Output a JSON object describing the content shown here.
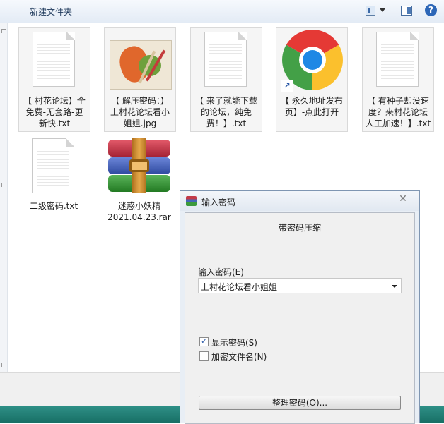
{
  "toolbar": {
    "new_folder": "新建文件夹",
    "help_glyph": "?"
  },
  "files": [
    {
      "label": "【 村花论坛】全\n免费-无套路-更\n新快.txt",
      "icon": "text-file-icon"
    },
    {
      "label": "【 解压密码：】\n上村花论坛看小\n姐姐.jpg",
      "icon": "image-thumbnail"
    },
    {
      "label": "【 来了就能下载\n的论坛，纯免\n费！】.txt",
      "icon": "text-file-icon"
    },
    {
      "label": "【 永久地址发布\n页】-点此打开",
      "icon": "chrome-icon"
    },
    {
      "label": "【 有种子却没速\n度？来村花论坛\n人工加速！】.txt",
      "icon": "text-file-icon"
    },
    {
      "label": "二级密码.txt",
      "icon": "text-file-icon"
    },
    {
      "label": "迷惑小妖精\n2021.04.23.rar",
      "icon": "winrar-archive-icon"
    }
  ],
  "dialog": {
    "title": "输入密码",
    "close_glyph": "✕",
    "heading": "带密码压缩",
    "password_label": "输入密码(E)",
    "password_value": "上村花论坛看小姐姐",
    "show_password_label": "显示密码(S)",
    "show_password_checked": true,
    "encrypt_names_label": "加密文件名(N)",
    "encrypt_names_checked": false,
    "organize_button": "整理密码(O)...",
    "check_glyph": "✓"
  },
  "colors": {
    "accent": "#2c66b7",
    "taskbar": "#1f7e74"
  }
}
